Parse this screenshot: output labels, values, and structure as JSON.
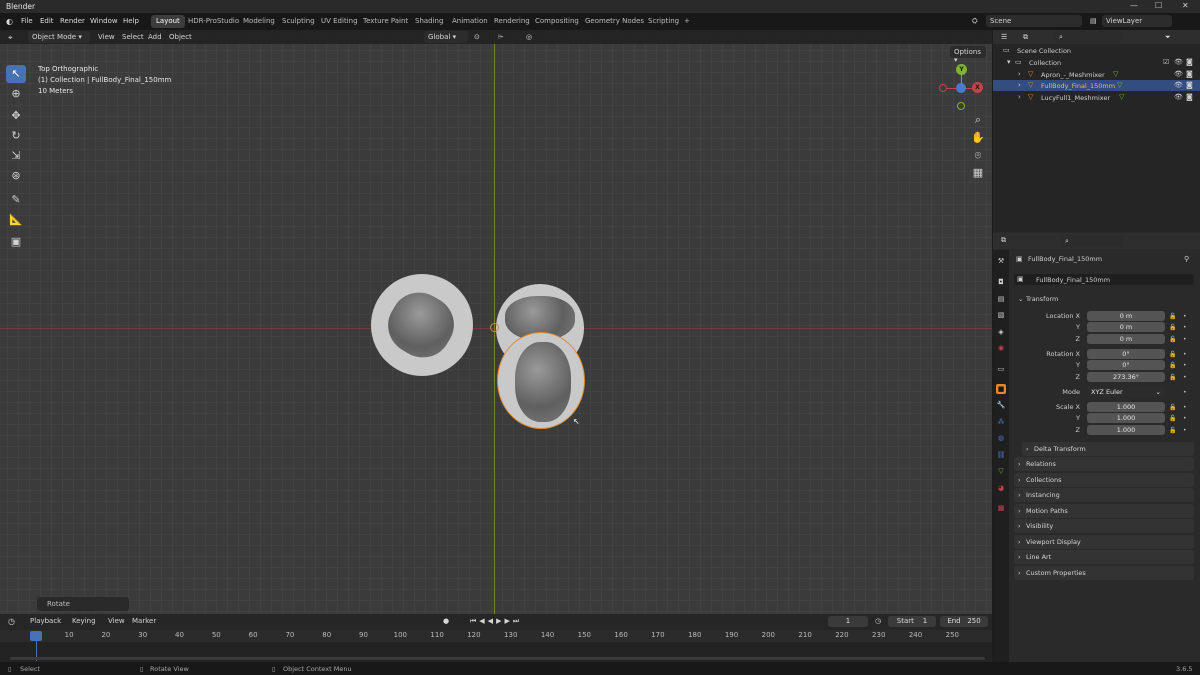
{
  "window": {
    "title": "Blender",
    "controls": [
      "—",
      "☐",
      "✕"
    ]
  },
  "menu": [
    "File",
    "Edit",
    "Render",
    "Window",
    "Help"
  ],
  "workspaces": [
    "Layout",
    "HDR-ProStudio",
    "Modeling",
    "Sculpting",
    "UV Editing",
    "Texture Paint",
    "Shading",
    "Animation",
    "Rendering",
    "Compositing",
    "Geometry Nodes",
    "Scripting",
    "+"
  ],
  "scene": {
    "label": "Scene",
    "viewlayer": "ViewLayer"
  },
  "viewport_header": {
    "mode": "Object Mode",
    "menus": [
      "View",
      "Select",
      "Add",
      "Object"
    ],
    "orientation": "Global",
    "options": "Options"
  },
  "viewport_overlay": {
    "view_name": "Top Orthographic",
    "collection": "(1) Collection | FullBody_Final_150mm",
    "scale": "10 Meters"
  },
  "gizmo": {
    "y": "Y",
    "x": "X"
  },
  "operator_panel": "Rotate",
  "timeline": {
    "menus": [
      "Playback",
      "Keying",
      "View",
      "Marker"
    ],
    "current_frame": "1",
    "start_label": "Start",
    "start": "1",
    "end_label": "End",
    "end": "250",
    "ruler": [
      "1",
      "10",
      "20",
      "30",
      "40",
      "50",
      "60",
      "70",
      "80",
      "90",
      "100",
      "110",
      "120",
      "130",
      "140",
      "150",
      "160",
      "170",
      "180",
      "190",
      "200",
      "210",
      "220",
      "230",
      "240",
      "250"
    ]
  },
  "status_bar": {
    "select": "Select",
    "rotate": "Rotate View",
    "context": "Object Context Menu",
    "version": "3.6.5"
  },
  "outliner": {
    "scene_collection": "Scene Collection",
    "collection": "Collection",
    "items": [
      "Apron_-_Meshmixer",
      "FullBody_Final_150mm",
      "LucyFull1_Meshmixer"
    ]
  },
  "properties": {
    "object_name": "FullBody_Final_150mm",
    "object_field": "FullBody_Final_150mm",
    "transform": "Transform",
    "location_label": "Location X",
    "y_label": "Y",
    "z_label": "Z",
    "location": [
      "0 m",
      "0 m",
      "0 m"
    ],
    "rotation_label": "Rotation X",
    "rotation": [
      "0°",
      "0°",
      "273.36°"
    ],
    "mode_label": "Mode",
    "mode": "XYZ Euler",
    "scale_label": "Scale X",
    "scale": [
      "1.000",
      "1.000",
      "1.000"
    ],
    "sections": [
      "Delta Transform",
      "Relations",
      "Collections",
      "Instancing",
      "Motion Paths",
      "Visibility",
      "Viewport Display",
      "Line Art",
      "Custom Properties"
    ]
  },
  "colors": {
    "accent": "#4772b3",
    "selection": "#e08a2c",
    "x_axis": "#c0434a",
    "y_axis": "#7fb32a"
  }
}
